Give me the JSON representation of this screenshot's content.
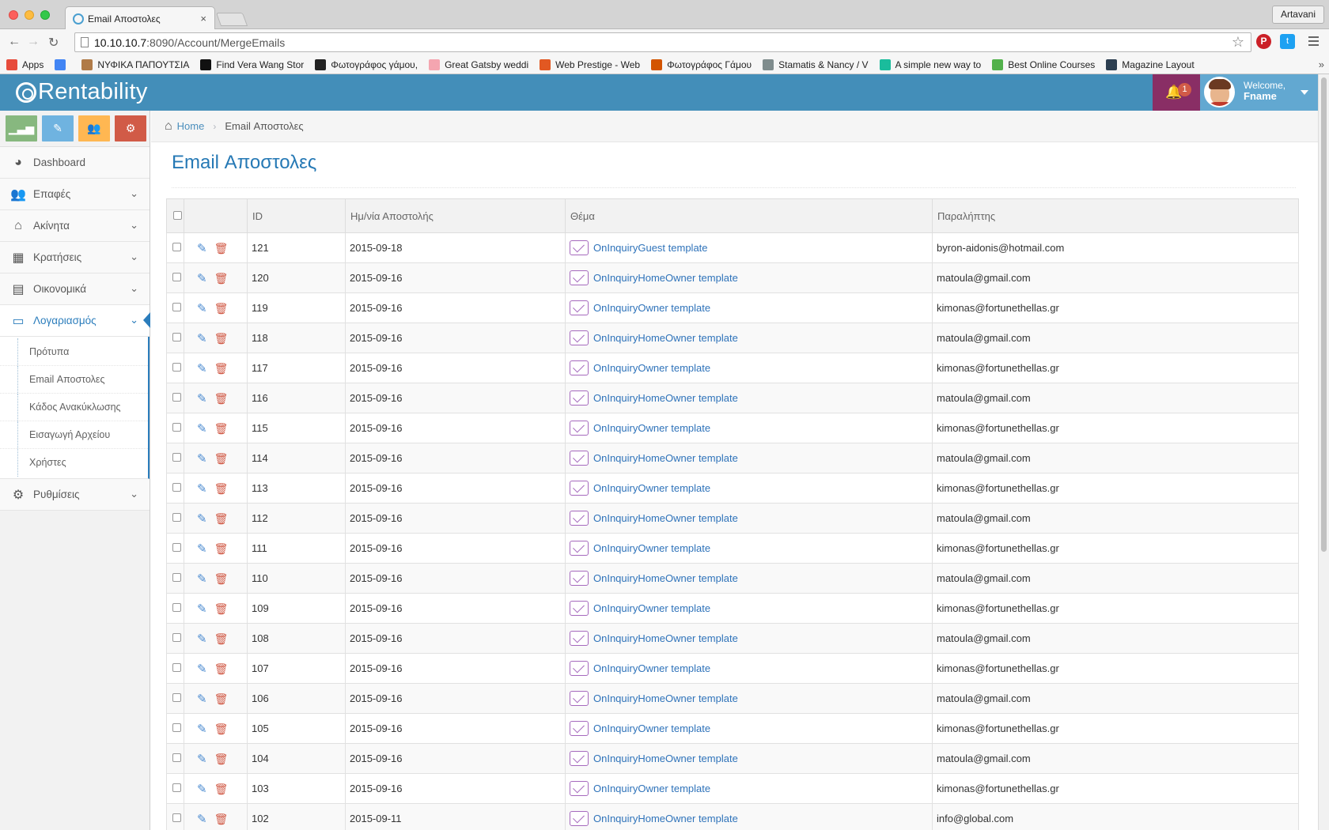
{
  "browser": {
    "tab_title": "Email Αποστολες",
    "profile_name": "Artavani",
    "url_host": "10.10.10.7",
    "url_path": ":8090/Account/MergeEmails",
    "bookmarks": [
      {
        "label": "Apps",
        "color": "#e74c3c"
      },
      {
        "label": "",
        "color": "#4285f4"
      },
      {
        "label": "ΝΥΦΙΚΑ ΠΑΠΟΥΤΣΙΑ",
        "color": "#b07b48"
      },
      {
        "label": "Find Vera Wang Stor",
        "color": "#111111"
      },
      {
        "label": "Φωτογράφος γάμου,",
        "color": "#222222"
      },
      {
        "label": "Great Gatsby weddi",
        "color": "#f4a5b0"
      },
      {
        "label": "Web Prestige - Web",
        "color": "#e25822"
      },
      {
        "label": "Φωτογράφος Γάμου",
        "color": "#d35400"
      },
      {
        "label": "Stamatis & Nancy / V",
        "color": "#7f8c8d"
      },
      {
        "label": "A simple new way to",
        "color": "#1abc9c"
      },
      {
        "label": "Best Online Courses",
        "color": "#52b14b"
      },
      {
        "label": "Magazine Layout",
        "color": "#2c3e50"
      }
    ]
  },
  "app": {
    "brand": "Rentability",
    "notifications_count": "1",
    "welcome_line": "Welcome,",
    "user_name": "Fname"
  },
  "sidebar": {
    "items": [
      {
        "label": "Dashboard",
        "icon": "tachometer-icon",
        "glyph": "◕",
        "has_children": false,
        "active": false
      },
      {
        "label": "Επαφές",
        "icon": "users-icon",
        "glyph": "👥",
        "has_children": true,
        "active": false
      },
      {
        "label": "Ακίνητα",
        "icon": "home-icon",
        "glyph": "⌂",
        "has_children": true,
        "active": false
      },
      {
        "label": "Κρατήσεις",
        "icon": "calendar-icon",
        "glyph": "▦",
        "has_children": true,
        "active": false
      },
      {
        "label": "Οικονομικά",
        "icon": "file-icon",
        "glyph": "▤",
        "has_children": true,
        "active": false
      },
      {
        "label": "Λογαριασμός",
        "icon": "desktop-icon",
        "glyph": "▭",
        "has_children": true,
        "active": true
      }
    ],
    "submenu": [
      "Πρότυπα",
      "Email Αποστολες",
      "Κάδος Ανακύκλωσης",
      "Εισαγωγή Αρχείου",
      "Χρήστες"
    ],
    "settings_label": "Ρυθμίσεις"
  },
  "breadcrumb": {
    "home": "Home",
    "current": "Email Αποστολες"
  },
  "page": {
    "title": "Email Αποστολες"
  },
  "table": {
    "columns": [
      "ID",
      "Ημ/νία Αποστολής",
      "Θέμα",
      "Παραλήπτης"
    ],
    "rows": [
      {
        "id": "121",
        "date": "2015-09-18",
        "subject": "OnInquiryGuest template",
        "recipient": "byron-aidonis@hotmail.com"
      },
      {
        "id": "120",
        "date": "2015-09-16",
        "subject": "OnInquiryHomeOwner template",
        "recipient": "matoula@gmail.com"
      },
      {
        "id": "119",
        "date": "2015-09-16",
        "subject": "OnInquiryOwner template",
        "recipient": "kimonas@fortunethellas.gr"
      },
      {
        "id": "118",
        "date": "2015-09-16",
        "subject": "OnInquiryHomeOwner template",
        "recipient": "matoula@gmail.com"
      },
      {
        "id": "117",
        "date": "2015-09-16",
        "subject": "OnInquiryOwner template",
        "recipient": "kimonas@fortunethellas.gr"
      },
      {
        "id": "116",
        "date": "2015-09-16",
        "subject": "OnInquiryHomeOwner template",
        "recipient": "matoula@gmail.com"
      },
      {
        "id": "115",
        "date": "2015-09-16",
        "subject": "OnInquiryOwner template",
        "recipient": "kimonas@fortunethellas.gr"
      },
      {
        "id": "114",
        "date": "2015-09-16",
        "subject": "OnInquiryHomeOwner template",
        "recipient": "matoula@gmail.com"
      },
      {
        "id": "113",
        "date": "2015-09-16",
        "subject": "OnInquiryOwner template",
        "recipient": "kimonas@fortunethellas.gr"
      },
      {
        "id": "112",
        "date": "2015-09-16",
        "subject": "OnInquiryHomeOwner template",
        "recipient": "matoula@gmail.com"
      },
      {
        "id": "111",
        "date": "2015-09-16",
        "subject": "OnInquiryOwner template",
        "recipient": "kimonas@fortunethellas.gr"
      },
      {
        "id": "110",
        "date": "2015-09-16",
        "subject": "OnInquiryHomeOwner template",
        "recipient": "matoula@gmail.com"
      },
      {
        "id": "109",
        "date": "2015-09-16",
        "subject": "OnInquiryOwner template",
        "recipient": "kimonas@fortunethellas.gr"
      },
      {
        "id": "108",
        "date": "2015-09-16",
        "subject": "OnInquiryHomeOwner template",
        "recipient": "matoula@gmail.com"
      },
      {
        "id": "107",
        "date": "2015-09-16",
        "subject": "OnInquiryOwner template",
        "recipient": "kimonas@fortunethellas.gr"
      },
      {
        "id": "106",
        "date": "2015-09-16",
        "subject": "OnInquiryHomeOwner template",
        "recipient": "matoula@gmail.com"
      },
      {
        "id": "105",
        "date": "2015-09-16",
        "subject": "OnInquiryOwner template",
        "recipient": "kimonas@fortunethellas.gr"
      },
      {
        "id": "104",
        "date": "2015-09-16",
        "subject": "OnInquiryHomeOwner template",
        "recipient": "matoula@gmail.com"
      },
      {
        "id": "103",
        "date": "2015-09-16",
        "subject": "OnInquiryOwner template",
        "recipient": "kimonas@fortunethellas.gr"
      },
      {
        "id": "102",
        "date": "2015-09-11",
        "subject": "OnInquiryHomeOwner template",
        "recipient": "info@global.com"
      }
    ]
  },
  "colors": {
    "header": "#438eb9",
    "notif": "#892e65",
    "accent": "#2679b5",
    "link": "#2f73ba"
  }
}
